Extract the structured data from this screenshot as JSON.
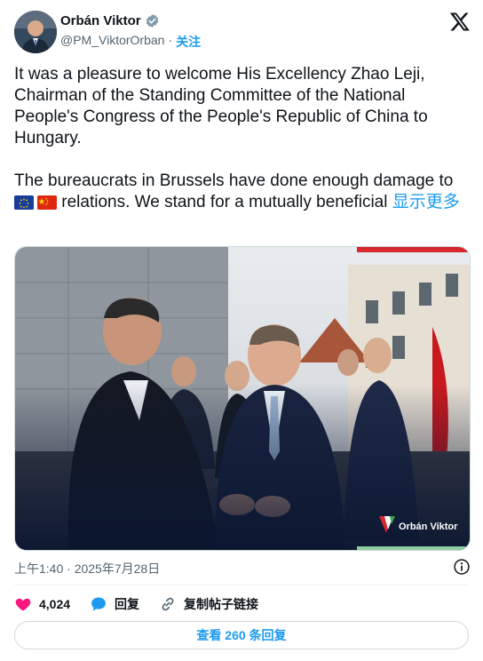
{
  "author": {
    "name": "Orbán Viktor",
    "handle": "@PM_ViktorOrban",
    "separator": "·",
    "follow_label": "关注"
  },
  "tweet": {
    "paragraph1": "It was a pleasure to welcome His Excellency Zhao Leji, Chairman of the Standing Committee of the National People's Congress of the People's Republic of China to Hungary.",
    "paragraph2_start": "The bureaucrats in Brussels have done enough damage to",
    "paragraph2_end": " relations. We stand for a mutually beneficial ",
    "show_more": "显示更多"
  },
  "media": {
    "watermark": "Orbán Viktor"
  },
  "meta": {
    "timestamp": "上午1:40 · 2025年7月28日"
  },
  "actions": {
    "likes": "4,024",
    "reply_label": "回复",
    "copy_link_label": "复制帖子链接"
  },
  "replies_button": "查看 260 条回复",
  "colors": {
    "accent": "#1d9bf0",
    "like": "#f91880",
    "verified": "#829aab"
  },
  "icons": [
    "verified-badge-icon",
    "x-logo-icon",
    "info-icon",
    "heart-icon",
    "speech-bubble-icon",
    "link-icon"
  ]
}
